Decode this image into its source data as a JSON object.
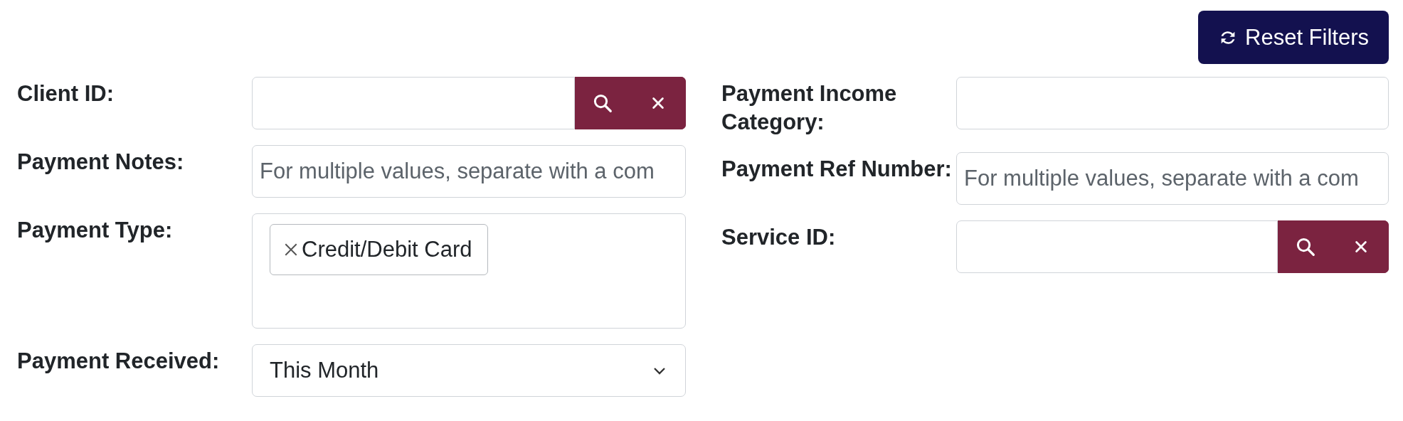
{
  "reset_button": {
    "label": "Reset Filters"
  },
  "columns": [
    [
      {
        "kind": "search",
        "label": "Client ID:"
      },
      {
        "kind": "text",
        "label": "Payment Notes:",
        "placeholder": "For multiple values, separate with a com"
      },
      {
        "kind": "tags",
        "label": "Payment Type:",
        "tags": [
          "Credit/Debit Card"
        ]
      },
      {
        "kind": "select",
        "label": "Payment Received:",
        "value": "This Month"
      }
    ],
    [
      {
        "kind": "text",
        "label": "Payment Income Category:"
      },
      {
        "kind": "text",
        "label": "Payment Ref Number:",
        "placeholder": "For multiple values, separate with a com"
      },
      {
        "kind": "search",
        "label": "Service ID:"
      }
    ]
  ]
}
